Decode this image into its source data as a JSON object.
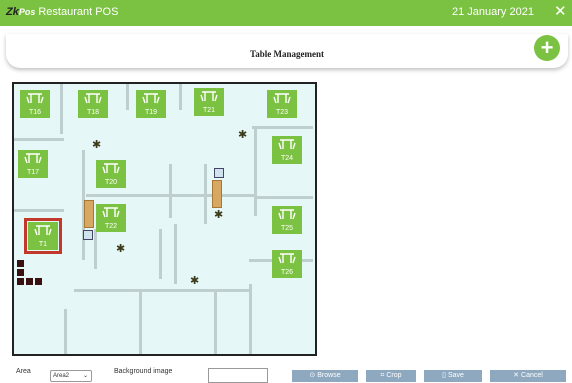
{
  "app": {
    "brand_z": "Zk",
    "brand_pos": "Pos",
    "title": "Restaurant POS",
    "date": "21 January 2021",
    "close_glyph": "✕"
  },
  "header": {
    "title": "Table Management",
    "add_glyph": "+"
  },
  "colors": {
    "accent": "#7cc242",
    "button": "#8ea8c0",
    "selected": "#c0392b",
    "floor": "#e6f7f7"
  },
  "tables": [
    "T16",
    "T18",
    "T19",
    "T21",
    "T23",
    "T17",
    "T20",
    "T24",
    "T22",
    "T25",
    "T1",
    "T26"
  ],
  "selected_table": "T1",
  "controls": {
    "area_label": "Area",
    "area_value": "Area2",
    "bg_label": "Background image",
    "browse": "Browse",
    "crop": "Crop",
    "save": "Save",
    "cancel": "Cancel"
  },
  "icons": {
    "table": "dining-table-icon",
    "plant": "plant-icon",
    "sink": "sink-icon"
  }
}
